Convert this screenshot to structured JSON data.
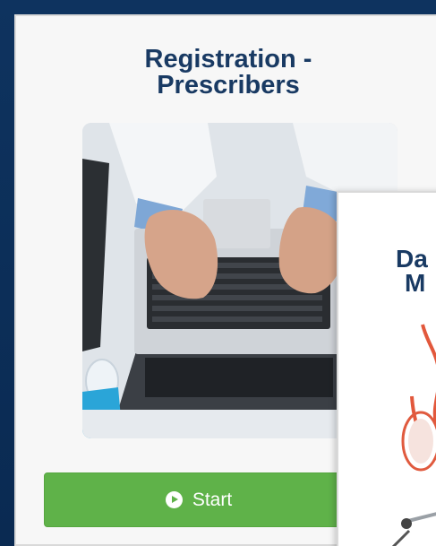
{
  "card_primary": {
    "title": "Registration -\nPrescribers",
    "start_label": "Start",
    "start_button_color": "#5fb249",
    "title_color": "#193a63",
    "image_subject": "hands typing on laptop"
  },
  "card_secondary": {
    "title_line1": "Da",
    "title_line2": "M",
    "image_subject": "medical device"
  },
  "background_color": "#0b2d55"
}
